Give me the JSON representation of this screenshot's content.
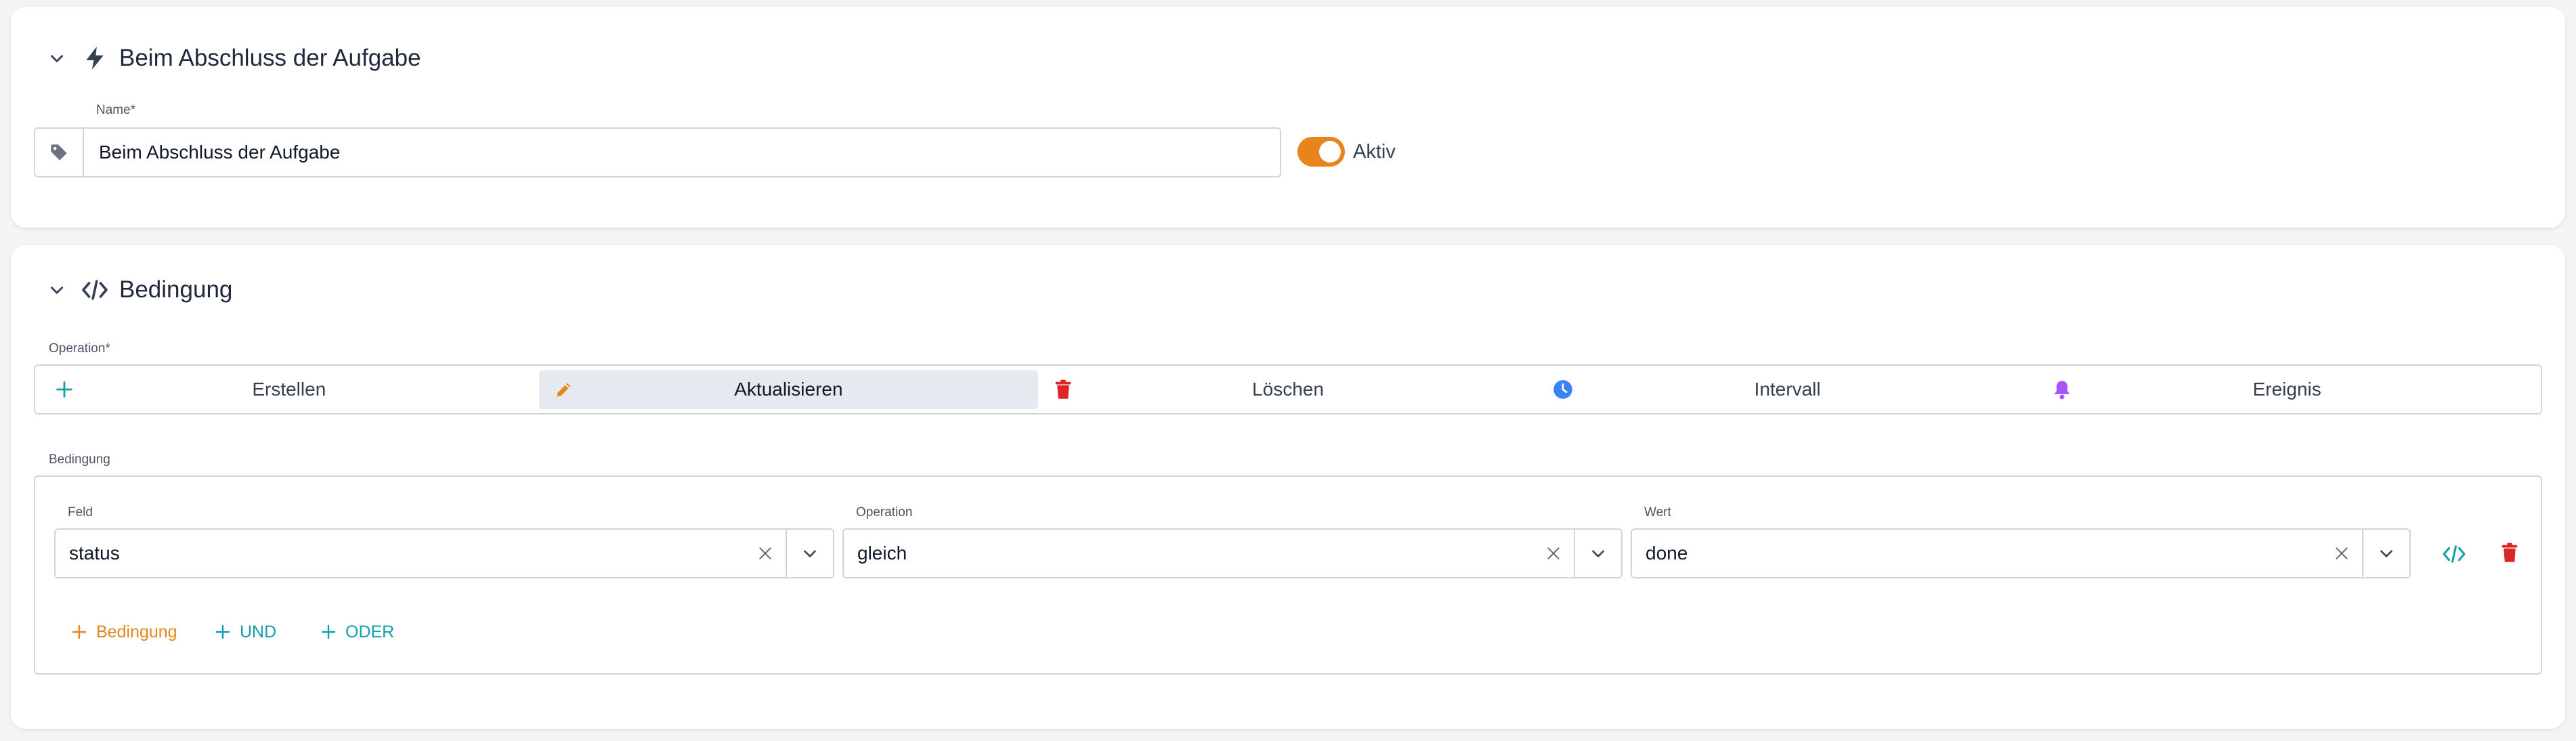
{
  "trigger_section": {
    "title": "Beim Abschluss der Aufgabe",
    "name_label": "Name*",
    "name_value": "Beim Abschluss der Aufgabe",
    "active_label": "Aktiv",
    "active": true
  },
  "condition_section": {
    "title": "Bedingung",
    "operation_label": "Operation*",
    "operations": [
      {
        "label": "Erstellen",
        "icon": "plus-icon",
        "active": false
      },
      {
        "label": "Aktualisieren",
        "icon": "pencil-icon",
        "active": true
      },
      {
        "label": "Löschen",
        "icon": "trash-icon",
        "active": false
      },
      {
        "label": "Intervall",
        "icon": "clock-icon",
        "active": false
      },
      {
        "label": "Ereignis",
        "icon": "bell-icon",
        "active": false
      }
    ],
    "condition_label": "Bedingung",
    "rule": {
      "field_label": "Feld",
      "field_value": "status",
      "operation_label": "Operation",
      "operation_value": "gleich",
      "value_label": "Wert",
      "value_value": "done"
    },
    "add_condition": "Bedingung",
    "add_and": "UND",
    "add_or": "ODER"
  },
  "colors": {
    "accent_orange": "#e8841c",
    "teal": "#0e9fa8",
    "red": "#dc2626",
    "blue": "#3b82f6",
    "purple": "#a855f7"
  }
}
